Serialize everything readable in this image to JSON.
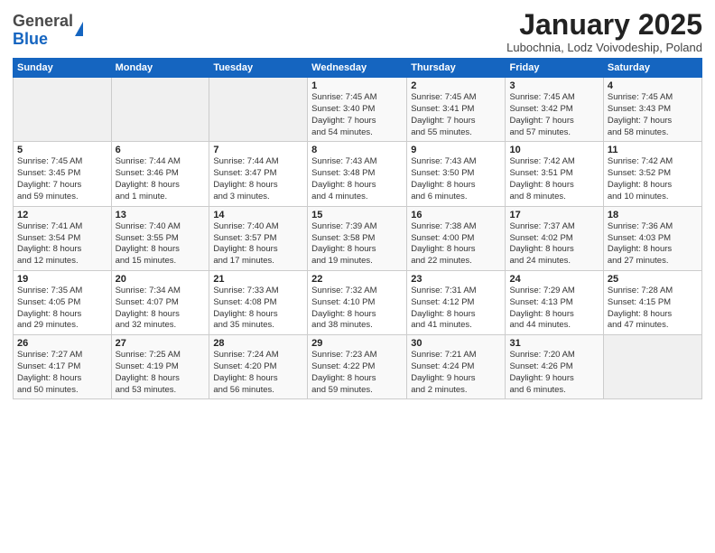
{
  "logo": {
    "general": "General",
    "blue": "Blue"
  },
  "title": "January 2025",
  "subtitle": "Lubochnia, Lodz Voivodeship, Poland",
  "weekdays": [
    "Sunday",
    "Monday",
    "Tuesday",
    "Wednesday",
    "Thursday",
    "Friday",
    "Saturday"
  ],
  "weeks": [
    [
      {
        "day": "",
        "info": ""
      },
      {
        "day": "",
        "info": ""
      },
      {
        "day": "",
        "info": ""
      },
      {
        "day": "1",
        "info": "Sunrise: 7:45 AM\nSunset: 3:40 PM\nDaylight: 7 hours\nand 54 minutes."
      },
      {
        "day": "2",
        "info": "Sunrise: 7:45 AM\nSunset: 3:41 PM\nDaylight: 7 hours\nand 55 minutes."
      },
      {
        "day": "3",
        "info": "Sunrise: 7:45 AM\nSunset: 3:42 PM\nDaylight: 7 hours\nand 57 minutes."
      },
      {
        "day": "4",
        "info": "Sunrise: 7:45 AM\nSunset: 3:43 PM\nDaylight: 7 hours\nand 58 minutes."
      }
    ],
    [
      {
        "day": "5",
        "info": "Sunrise: 7:45 AM\nSunset: 3:45 PM\nDaylight: 7 hours\nand 59 minutes."
      },
      {
        "day": "6",
        "info": "Sunrise: 7:44 AM\nSunset: 3:46 PM\nDaylight: 8 hours\nand 1 minute."
      },
      {
        "day": "7",
        "info": "Sunrise: 7:44 AM\nSunset: 3:47 PM\nDaylight: 8 hours\nand 3 minutes."
      },
      {
        "day": "8",
        "info": "Sunrise: 7:43 AM\nSunset: 3:48 PM\nDaylight: 8 hours\nand 4 minutes."
      },
      {
        "day": "9",
        "info": "Sunrise: 7:43 AM\nSunset: 3:50 PM\nDaylight: 8 hours\nand 6 minutes."
      },
      {
        "day": "10",
        "info": "Sunrise: 7:42 AM\nSunset: 3:51 PM\nDaylight: 8 hours\nand 8 minutes."
      },
      {
        "day": "11",
        "info": "Sunrise: 7:42 AM\nSunset: 3:52 PM\nDaylight: 8 hours\nand 10 minutes."
      }
    ],
    [
      {
        "day": "12",
        "info": "Sunrise: 7:41 AM\nSunset: 3:54 PM\nDaylight: 8 hours\nand 12 minutes."
      },
      {
        "day": "13",
        "info": "Sunrise: 7:40 AM\nSunset: 3:55 PM\nDaylight: 8 hours\nand 15 minutes."
      },
      {
        "day": "14",
        "info": "Sunrise: 7:40 AM\nSunset: 3:57 PM\nDaylight: 8 hours\nand 17 minutes."
      },
      {
        "day": "15",
        "info": "Sunrise: 7:39 AM\nSunset: 3:58 PM\nDaylight: 8 hours\nand 19 minutes."
      },
      {
        "day": "16",
        "info": "Sunrise: 7:38 AM\nSunset: 4:00 PM\nDaylight: 8 hours\nand 22 minutes."
      },
      {
        "day": "17",
        "info": "Sunrise: 7:37 AM\nSunset: 4:02 PM\nDaylight: 8 hours\nand 24 minutes."
      },
      {
        "day": "18",
        "info": "Sunrise: 7:36 AM\nSunset: 4:03 PM\nDaylight: 8 hours\nand 27 minutes."
      }
    ],
    [
      {
        "day": "19",
        "info": "Sunrise: 7:35 AM\nSunset: 4:05 PM\nDaylight: 8 hours\nand 29 minutes."
      },
      {
        "day": "20",
        "info": "Sunrise: 7:34 AM\nSunset: 4:07 PM\nDaylight: 8 hours\nand 32 minutes."
      },
      {
        "day": "21",
        "info": "Sunrise: 7:33 AM\nSunset: 4:08 PM\nDaylight: 8 hours\nand 35 minutes."
      },
      {
        "day": "22",
        "info": "Sunrise: 7:32 AM\nSunset: 4:10 PM\nDaylight: 8 hours\nand 38 minutes."
      },
      {
        "day": "23",
        "info": "Sunrise: 7:31 AM\nSunset: 4:12 PM\nDaylight: 8 hours\nand 41 minutes."
      },
      {
        "day": "24",
        "info": "Sunrise: 7:29 AM\nSunset: 4:13 PM\nDaylight: 8 hours\nand 44 minutes."
      },
      {
        "day": "25",
        "info": "Sunrise: 7:28 AM\nSunset: 4:15 PM\nDaylight: 8 hours\nand 47 minutes."
      }
    ],
    [
      {
        "day": "26",
        "info": "Sunrise: 7:27 AM\nSunset: 4:17 PM\nDaylight: 8 hours\nand 50 minutes."
      },
      {
        "day": "27",
        "info": "Sunrise: 7:25 AM\nSunset: 4:19 PM\nDaylight: 8 hours\nand 53 minutes."
      },
      {
        "day": "28",
        "info": "Sunrise: 7:24 AM\nSunset: 4:20 PM\nDaylight: 8 hours\nand 56 minutes."
      },
      {
        "day": "29",
        "info": "Sunrise: 7:23 AM\nSunset: 4:22 PM\nDaylight: 8 hours\nand 59 minutes."
      },
      {
        "day": "30",
        "info": "Sunrise: 7:21 AM\nSunset: 4:24 PM\nDaylight: 9 hours\nand 2 minutes."
      },
      {
        "day": "31",
        "info": "Sunrise: 7:20 AM\nSunset: 4:26 PM\nDaylight: 9 hours\nand 6 minutes."
      },
      {
        "day": "",
        "info": ""
      }
    ]
  ]
}
